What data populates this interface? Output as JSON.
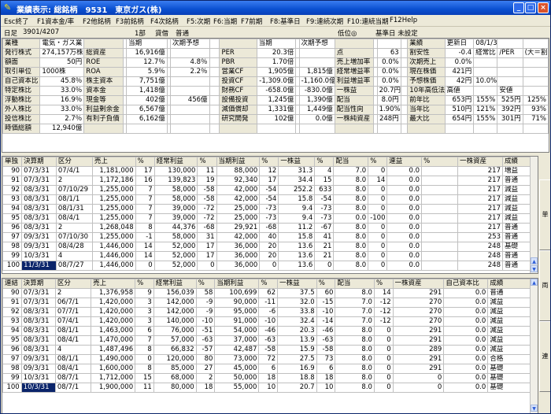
{
  "window": {
    "title": "業績表示: 総銘柄　9531　東京ガス(株)"
  },
  "menu": [
    "Esc終了",
    "F1資本金/率",
    "F2他銘柄",
    "F3前銘柄",
    "F4次銘柄",
    "F5:次期",
    "F6:当期",
    "F7前期",
    "F8:基準日",
    "F9:連続次期",
    "F10:連続当期",
    "F12Help"
  ],
  "info": {
    "date_label": "日足",
    "date_value": "3901/4207",
    "market": "1部",
    "credit": "貸借",
    "status": "普通",
    "level": "低位◎",
    "base_date": "基準日 未設定"
  },
  "top_rows": [
    [
      "業種",
      "電気・ガス業",
      "",
      "",
      "当期",
      "",
      "次期予想",
      "",
      "",
      "当期",
      "",
      "次期予想",
      "",
      "",
      "",
      "",
      "業績",
      "更新日",
      "08/1/31",
      "",
      ""
    ],
    [
      "発行株式",
      "274,157万株",
      "総資産",
      "",
      "16,916億",
      "",
      "",
      "",
      "PER",
      "20.3倍",
      "",
      "",
      "点",
      "",
      "63",
      "",
      "割安性",
      "-0.4",
      "経常比",
      "/PER",
      "(大＝割安)"
    ],
    [
      "額面",
      "50円",
      "ROE",
      "",
      "12.7％",
      "",
      "4.8％",
      "",
      "PBR",
      "1.70倍",
      "",
      "",
      "売上増加率",
      "",
      "0.0%",
      "",
      "次期売上",
      "0.0%",
      "",
      "",
      ""
    ],
    [
      "取引単位",
      "1000株",
      "ROA",
      "",
      "5.9％",
      "",
      "2.2％",
      "",
      "営業CF",
      "1,905億",
      "",
      "1,815億",
      "経常増益率",
      "",
      "0.0%",
      "",
      "現在株価",
      "421円",
      "",
      "",
      ""
    ],
    [
      "自己資本比",
      "45.8％",
      "株主資本",
      "",
      "7,751億",
      "",
      "",
      "",
      "投資CF",
      "-1,309.0億",
      "",
      "-1,160.0億",
      "利益増益率",
      "",
      "0.0%",
      "",
      "予想株価",
      "42円",
      "10.0%",
      "",
      ""
    ],
    [
      "特定株比",
      "33.0％",
      "資本金",
      "",
      "1,418億",
      "",
      "",
      "",
      "財務CF",
      "-658.0億",
      "",
      "-830.0億",
      "一株益",
      "",
      "20.7円",
      "",
      "10年高低法",
      "高値",
      "",
      "安値",
      ""
    ],
    [
      "浮動株比",
      "16.9％",
      "現金等",
      "",
      "402億",
      "",
      "456億",
      "",
      "設備投資",
      "1,245億",
      "",
      "1,390億",
      "配当",
      "",
      "8.0円",
      "",
      "前年比",
      "653円",
      "155%",
      "525円",
      "125%"
    ],
    [
      "外人株比",
      "33.0％",
      "利益剰余金",
      "",
      "6,567億",
      "",
      "",
      "",
      "減価償却",
      "1,331億",
      "",
      "1,449億",
      "配当性向",
      "",
      "1.90%",
      "",
      "当年比",
      "510円",
      "121%",
      "392円",
      "93%"
    ],
    [
      "投信株比",
      "2.7％",
      "有利子負債",
      "",
      "6,162億",
      "",
      "",
      "",
      "研究開発",
      "102億",
      "",
      "0.0億",
      "一株純資産",
      "",
      "248円",
      "",
      "最大比",
      "654円",
      "155%",
      "301円",
      "71%"
    ],
    [
      "時価総額",
      "12,940億",
      "",
      "",
      "",
      "",
      "",
      "",
      "",
      "",
      "",
      "",
      "",
      "",
      "",
      "",
      "",
      "",
      "",
      "",
      ""
    ]
  ],
  "grid1": {
    "headers": [
      "単独",
      "決算期",
      "区分",
      "売上",
      "%",
      "経常利益",
      "%",
      "当期利益",
      "%",
      "一株益",
      "%",
      "配当",
      "%",
      "連益",
      "%",
      "一株資産",
      "成績"
    ],
    "rows": [
      [
        "90",
        "07/3/31",
        "07/4/1",
        "1,181,000",
        "17",
        "130,000",
        "11",
        "88,000",
        "12",
        "31.3",
        "4",
        "7.0",
        "0",
        "0.0",
        "",
        "217",
        "増益"
      ],
      [
        "91",
        "07/3/31",
        "2",
        "1,172,186",
        "16",
        "139,823",
        "19",
        "92,340",
        "17",
        "34.4",
        "15",
        "8.0",
        "14",
        "0.0",
        "",
        "217",
        "普通"
      ],
      [
        "92",
        "08/3/31",
        "07/10/29",
        "1,255,000",
        "7",
        "58,000",
        "-58",
        "42,000",
        "-54",
        "252.2",
        "633",
        "8.0",
        "0",
        "0.0",
        "",
        "217",
        "減益"
      ],
      [
        "93",
        "08/3/31",
        "08/1/1",
        "1,255,000",
        "7",
        "58,000",
        "-58",
        "42,000",
        "-54",
        "15.8",
        "-54",
        "8.0",
        "0",
        "0.0",
        "",
        "217",
        "減益"
      ],
      [
        "94",
        "08/3/31",
        "08/1/31",
        "1,255,000",
        "7",
        "39,000",
        "-72",
        "25,000",
        "-73",
        "9.4",
        "-73",
        "8.0",
        "0",
        "0.0",
        "",
        "217",
        "減益"
      ],
      [
        "95",
        "08/3/31",
        "08/4/1",
        "1,255,000",
        "7",
        "39,000",
        "-72",
        "25,000",
        "-73",
        "9.4",
        "-73",
        "0.0",
        "-100",
        "0.0",
        "",
        "217",
        "減益"
      ],
      [
        "96",
        "08/3/31",
        "2",
        "1,268,048",
        "8",
        "44,376",
        "-68",
        "29,921",
        "-68",
        "11.2",
        "-67",
        "8.0",
        "0",
        "0.0",
        "",
        "217",
        "普通"
      ],
      [
        "97",
        "09/3/31",
        "07/10/30",
        "1,255,000",
        "-1",
        "58,000",
        "31",
        "42,000",
        "40",
        "15.8",
        "41",
        "8.0",
        "0",
        "0.0",
        "",
        "253",
        "普通"
      ],
      [
        "98",
        "09/3/31",
        "08/4/28",
        "1,446,000",
        "14",
        "52,000",
        "17",
        "36,000",
        "20",
        "13.6",
        "21",
        "8.0",
        "0",
        "0.0",
        "",
        "248",
        "基礎"
      ],
      [
        "99",
        "10/3/31",
        "4",
        "1,446,000",
        "14",
        "52,000",
        "17",
        "36,000",
        "20",
        "13.6",
        "21",
        "8.0",
        "0",
        "0.0",
        "",
        "248",
        "普通"
      ],
      [
        "100",
        "11/3/31",
        "08/7/27",
        "1,446,000",
        "0",
        "52,000",
        "0",
        "36,000",
        "0",
        "13.6",
        "0",
        "8.0",
        "0",
        "0.0",
        "",
        "248",
        "普通"
      ]
    ]
  },
  "grid2": {
    "headers": [
      "連結",
      "決算期",
      "区分",
      "売上",
      "%",
      "経常利益",
      "%",
      "当期利益",
      "%",
      "一株益",
      "%",
      "配当",
      "%",
      "一株資産",
      "自己資本比",
      "成績"
    ],
    "rows": [
      [
        "90",
        "07/3/31",
        "2",
        "1,376,958",
        "9",
        "156,039",
        "58",
        "100,699",
        "62",
        "37.5",
        "60",
        "8.0",
        "14",
        "291",
        "0.0",
        "普通"
      ],
      [
        "91",
        "07/3/31",
        "06/7/1",
        "1,420,000",
        "3",
        "142,000",
        "-9",
        "90,000",
        "-11",
        "32.0",
        "-15",
        "7.0",
        "-12",
        "270",
        "0.0",
        "減益"
      ],
      [
        "92",
        "08/3/31",
        "07/7/1",
        "1,420,000",
        "3",
        "142,000",
        "-9",
        "95,000",
        "-6",
        "33.8",
        "-10",
        "7.0",
        "-12",
        "270",
        "0.0",
        "減益"
      ],
      [
        "93",
        "08/3/31",
        "07/4/1",
        "1,420,000",
        "3",
        "140,000",
        "-10",
        "91,000",
        "-10",
        "32.4",
        "-14",
        "7.0",
        "-12",
        "270",
        "0.0",
        "減益"
      ],
      [
        "94",
        "08/3/31",
        "08/1/1",
        "1,463,000",
        "6",
        "76,000",
        "-51",
        "54,000",
        "-46",
        "20.3",
        "-46",
        "8.0",
        "0",
        "291",
        "0.0",
        "減益"
      ],
      [
        "95",
        "08/3/31",
        "08/4/1",
        "1,470,000",
        "7",
        "57,000",
        "-63",
        "37,000",
        "-63",
        "13.9",
        "-63",
        "8.0",
        "0",
        "291",
        "0.0",
        "減益"
      ],
      [
        "96",
        "08/3/31",
        "4",
        "1,487,496",
        "8",
        "66,832",
        "-57",
        "42,487",
        "-58",
        "15.9",
        "-58",
        "8.0",
        "0",
        "289",
        "0.0",
        "減益"
      ],
      [
        "97",
        "09/3/31",
        "08/1/1",
        "1,490,000",
        "0",
        "120,000",
        "80",
        "73,000",
        "72",
        "27.5",
        "73",
        "8.0",
        "0",
        "291",
        "0.0",
        "合格"
      ],
      [
        "98",
        "09/3/31",
        "08/4/1",
        "1,600,000",
        "8",
        "85,000",
        "27",
        "45,000",
        "6",
        "16.9",
        "6",
        "8.0",
        "0",
        "291",
        "0.0",
        "基礎"
      ],
      [
        "99",
        "10/3/31",
        "08/7/1",
        "1,712,000",
        "15",
        "68,000",
        "2",
        "50,000",
        "18",
        "18.8",
        "18",
        "8.0",
        "0",
        "0",
        "0.0",
        "基礎"
      ],
      [
        "100",
        "10/3/31",
        "08/7/1",
        "1,900,000",
        "11",
        "80,000",
        "18",
        "55,000",
        "10",
        "20.7",
        "10",
        "8.0",
        "0",
        "0",
        "0.0",
        "基礎"
      ]
    ]
  },
  "side_buttons": [
    "単",
    "両",
    "連"
  ]
}
